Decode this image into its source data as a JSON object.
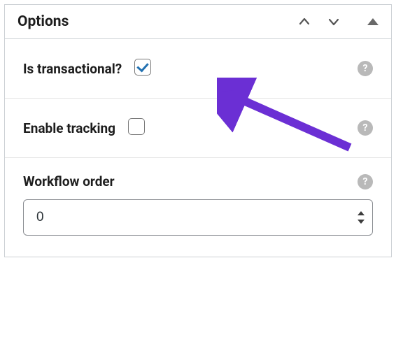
{
  "panel": {
    "title": "Options"
  },
  "options": {
    "transactional": {
      "label": "Is transactional?",
      "checked": true
    },
    "tracking": {
      "label": "Enable tracking",
      "checked": false
    },
    "workflow": {
      "label": "Workflow order",
      "value": "0"
    }
  },
  "icons": {
    "help": "?"
  },
  "annotation": {
    "color": "#6b2fd4"
  }
}
